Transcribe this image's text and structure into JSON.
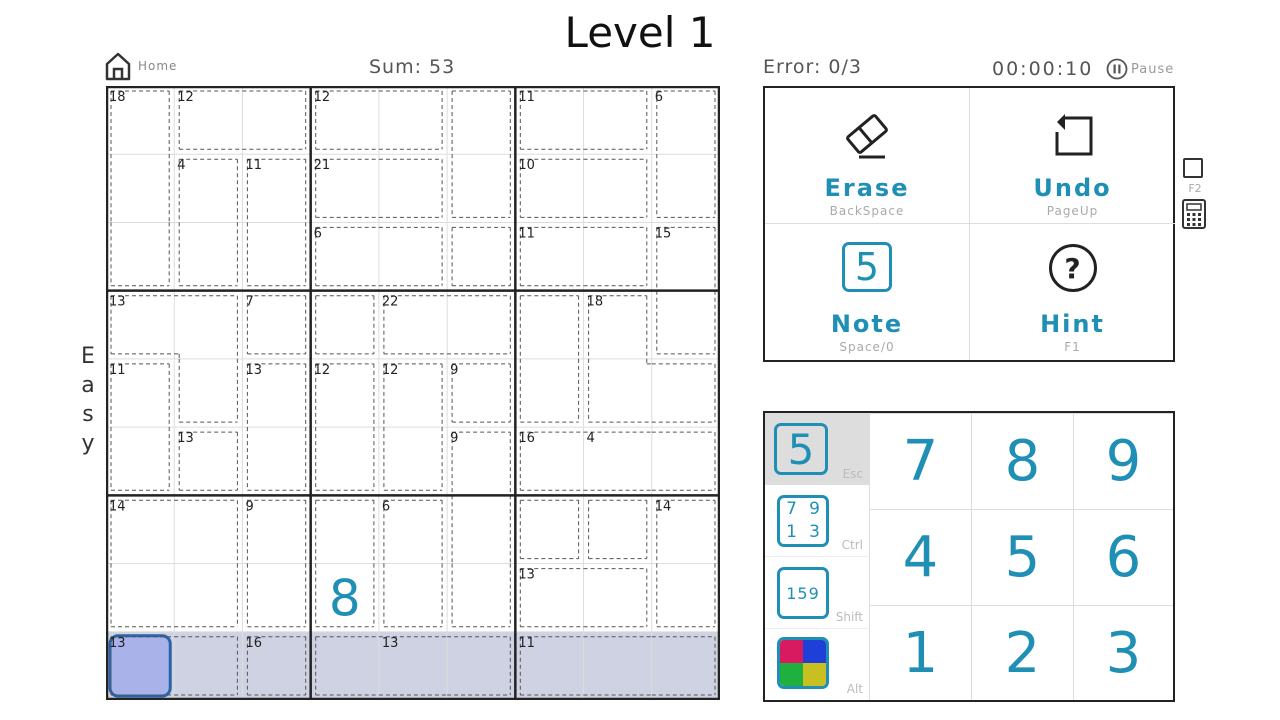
{
  "header": {
    "title": "Level 1",
    "home_label": "Home",
    "sum_text": "Sum: 53",
    "error_text": "Error: 0/3",
    "timer": "00:00:10",
    "pause_label": "Pause",
    "difficulty": [
      "E",
      "a",
      "s",
      "y"
    ]
  },
  "board": {
    "cage_sums": [
      {
        "row": 0,
        "col": 0,
        "sum": "18"
      },
      {
        "row": 0,
        "col": 1,
        "sum": "12"
      },
      {
        "row": 0,
        "col": 3,
        "sum": "12"
      },
      {
        "row": 0,
        "col": 6,
        "sum": "11"
      },
      {
        "row": 0,
        "col": 8,
        "sum": "6"
      },
      {
        "row": 1,
        "col": 1,
        "sum": "4"
      },
      {
        "row": 1,
        "col": 2,
        "sum": "11"
      },
      {
        "row": 1,
        "col": 3,
        "sum": "21"
      },
      {
        "row": 1,
        "col": 6,
        "sum": "10"
      },
      {
        "row": 2,
        "col": 3,
        "sum": "6"
      },
      {
        "row": 2,
        "col": 6,
        "sum": "11"
      },
      {
        "row": 2,
        "col": 8,
        "sum": "15"
      },
      {
        "row": 3,
        "col": 0,
        "sum": "13"
      },
      {
        "row": 3,
        "col": 2,
        "sum": "7"
      },
      {
        "row": 3,
        "col": 4,
        "sum": "22"
      },
      {
        "row": 3,
        "col": 7,
        "sum": "18"
      },
      {
        "row": 4,
        "col": 0,
        "sum": "11"
      },
      {
        "row": 4,
        "col": 2,
        "sum": "13"
      },
      {
        "row": 4,
        "col": 3,
        "sum": "12"
      },
      {
        "row": 4,
        "col": 4,
        "sum": "12"
      },
      {
        "row": 4,
        "col": 5,
        "sum": "9"
      },
      {
        "row": 5,
        "col": 1,
        "sum": "13"
      },
      {
        "row": 5,
        "col": 5,
        "sum": "9"
      },
      {
        "row": 5,
        "col": 6,
        "sum": "16"
      },
      {
        "row": 5,
        "col": 7,
        "sum": "4"
      },
      {
        "row": 6,
        "col": 0,
        "sum": "14"
      },
      {
        "row": 6,
        "col": 2,
        "sum": "9"
      },
      {
        "row": 6,
        "col": 4,
        "sum": "6"
      },
      {
        "row": 6,
        "col": 8,
        "sum": "14"
      },
      {
        "row": 7,
        "col": 6,
        "sum": "13"
      },
      {
        "row": 8,
        "col": 0,
        "sum": "13"
      },
      {
        "row": 8,
        "col": 2,
        "sum": "16"
      },
      {
        "row": 8,
        "col": 4,
        "sum": "13"
      },
      {
        "row": 8,
        "col": 6,
        "sum": "11"
      }
    ],
    "values": [
      {
        "row": 7,
        "col": 3,
        "value": "8"
      }
    ],
    "highlighted_row": 8,
    "selected_cell": {
      "row": 8,
      "col": 0
    }
  },
  "tools": [
    {
      "label": "Erase",
      "shortcut": "BackSpace",
      "icon": "eraser-icon"
    },
    {
      "label": "Undo",
      "shortcut": "PageUp",
      "icon": "undo-icon"
    },
    {
      "label": "Note",
      "shortcut": "Space/0",
      "icon": "note-icon",
      "icon_digit": "5"
    },
    {
      "label": "Hint",
      "shortcut": "F1",
      "icon": "hint-icon",
      "icon_text": "?"
    }
  ],
  "side": {
    "f2_label": "F2"
  },
  "input_modes": [
    {
      "name": "normal",
      "key": "Esc",
      "digits": "5",
      "active": true
    },
    {
      "name": "candidate",
      "key": "Ctrl",
      "digits": [
        "7",
        "9",
        "1",
        "3"
      ]
    },
    {
      "name": "multi",
      "key": "Shift",
      "digits": "159"
    },
    {
      "name": "color",
      "key": "Alt",
      "colors": [
        "#d81b60",
        "#1e3fd8",
        "#20b040",
        "#c8c020"
      ]
    }
  ],
  "numpad": [
    "7",
    "8",
    "9",
    "4",
    "5",
    "6",
    "1",
    "2",
    "3"
  ],
  "colors": {
    "accent": "#1f8fb6",
    "row_highlight": "#cfd2e2",
    "selected_cell": "#a9b3ea",
    "selected_border": "#2a64a8",
    "active_mode_bg": "#dddddd"
  }
}
